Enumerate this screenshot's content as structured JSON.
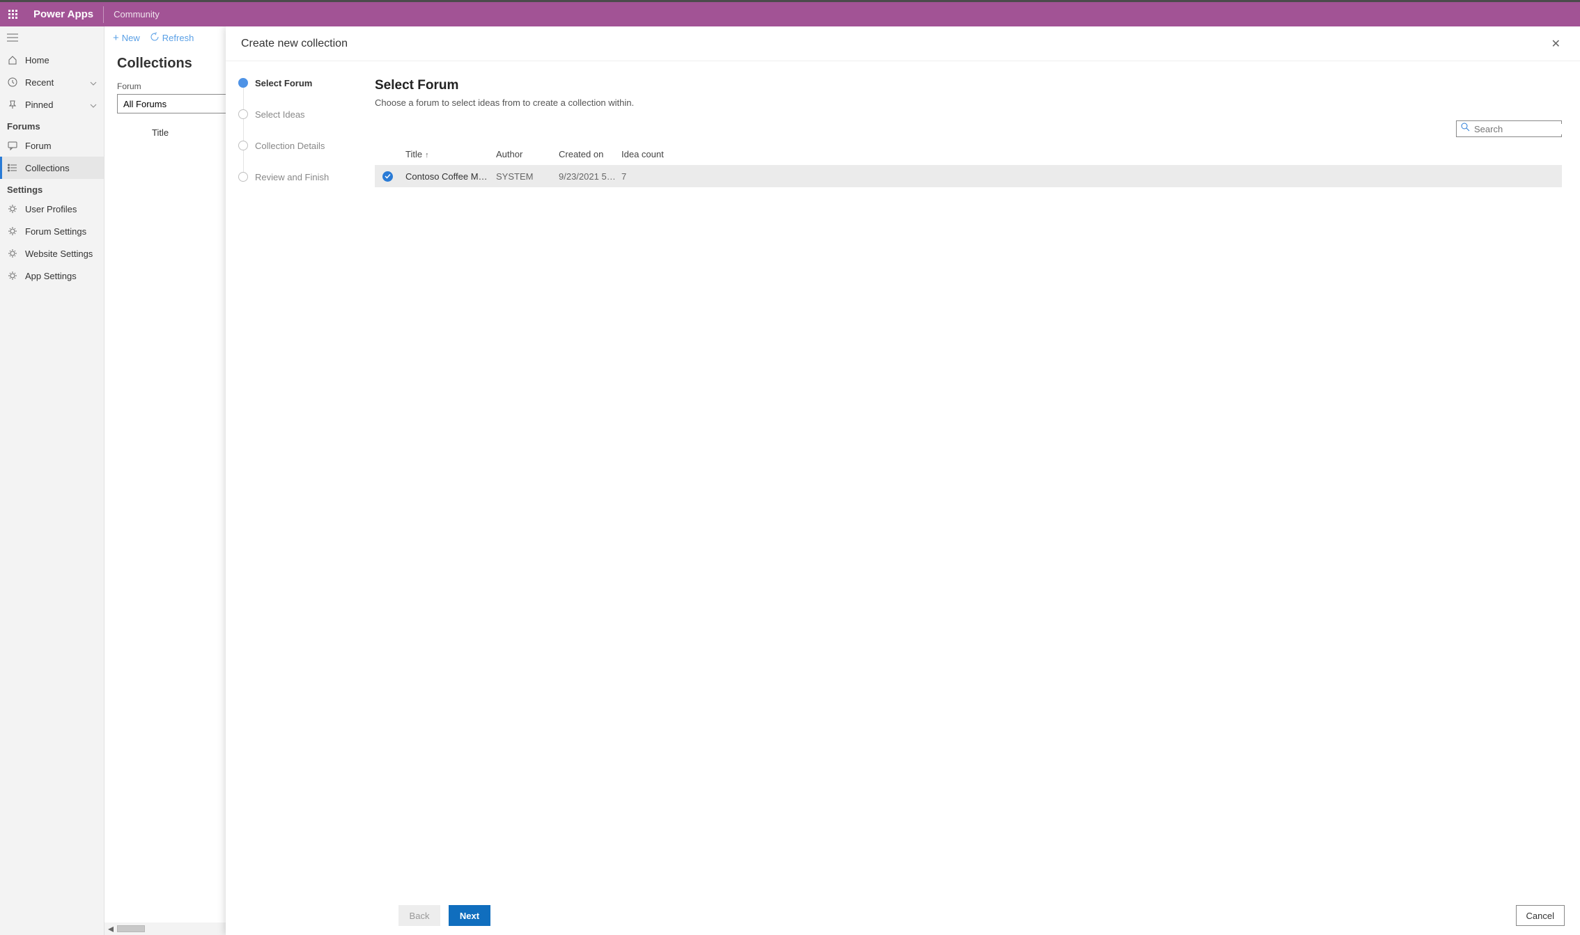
{
  "appbar": {
    "title": "Power Apps",
    "subtitle": "Community"
  },
  "nav": {
    "top": [
      {
        "label": "Home"
      },
      {
        "label": "Recent",
        "chevron": true
      },
      {
        "label": "Pinned",
        "chevron": true
      }
    ],
    "forums_section": "Forums",
    "forums": [
      {
        "label": "Forum"
      },
      {
        "label": "Collections",
        "selected": true
      }
    ],
    "settings_section": "Settings",
    "settings": [
      {
        "label": "User Profiles"
      },
      {
        "label": "Forum Settings"
      },
      {
        "label": "Website Settings"
      },
      {
        "label": "App Settings"
      }
    ]
  },
  "commands": {
    "new": "New",
    "refresh": "Refresh"
  },
  "mid": {
    "title": "Collections",
    "forum_label": "Forum",
    "forum_dropdown_value": "All Forums",
    "column_title": "Title"
  },
  "panel": {
    "header": "Create new collection",
    "steps": [
      "Select Forum",
      "Select Ideas",
      "Collection Details",
      "Review and Finish"
    ],
    "content": {
      "title": "Select Forum",
      "subtitle": "Choose a forum to select ideas from to create a collection within.",
      "search_placeholder": "Search",
      "columns": {
        "title": "Title",
        "author": "Author",
        "created": "Created on",
        "ideas": "Idea count"
      },
      "rows": [
        {
          "title": "Contoso Coffee Mach…",
          "author": "SYSTEM",
          "created": "9/23/2021 5:2…",
          "ideas": "7",
          "selected": true
        }
      ]
    },
    "footer": {
      "back": "Back",
      "next": "Next",
      "cancel": "Cancel"
    }
  }
}
